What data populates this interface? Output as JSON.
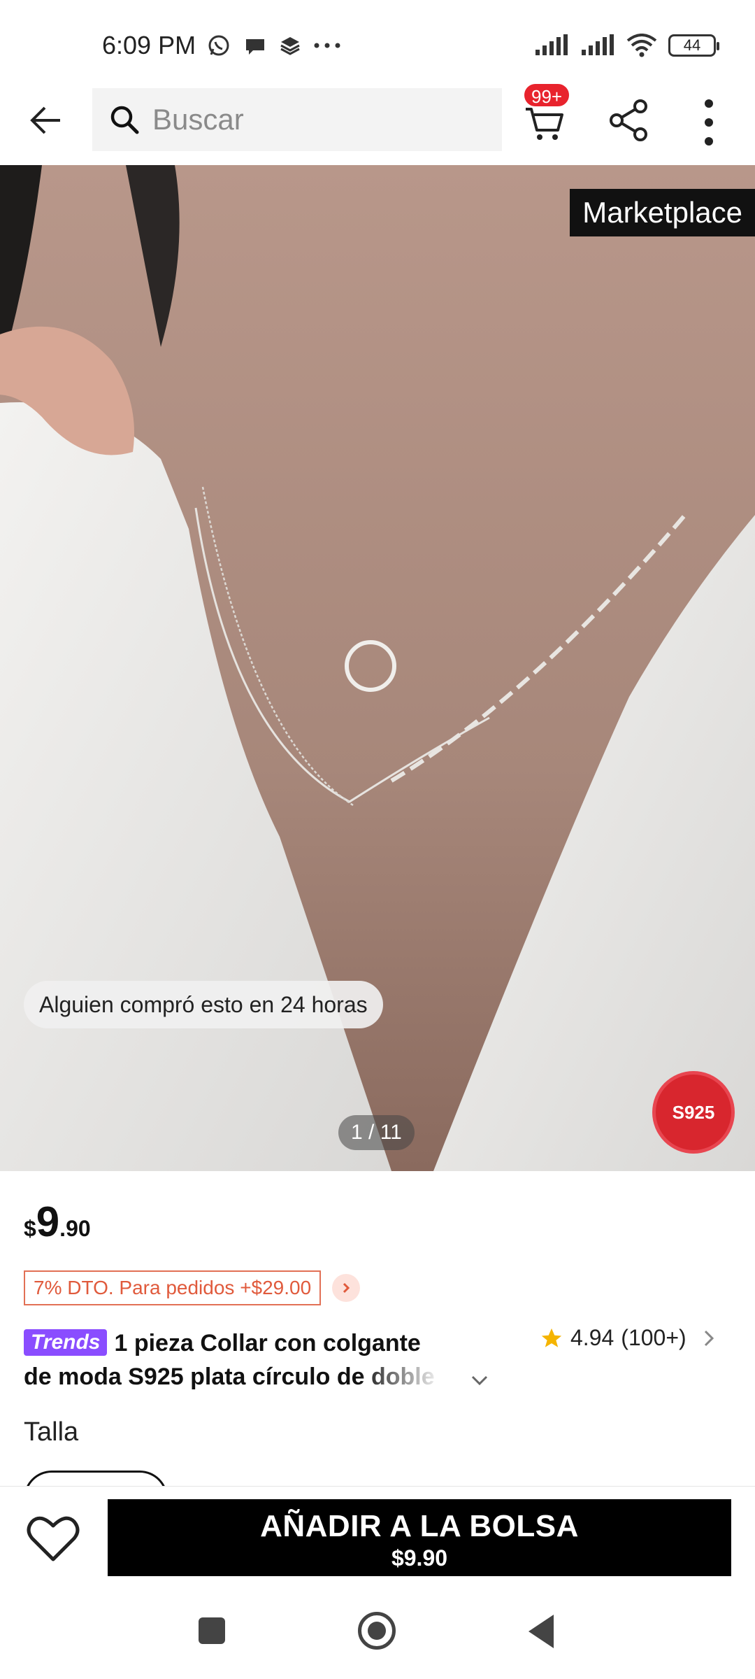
{
  "status_bar": {
    "time": "6:09 PM",
    "battery": "44",
    "icons": [
      "whatsapp-icon",
      "chat-bubble-icon",
      "layers-icon",
      "more-dots-icon",
      "signal-icon",
      "signal-icon",
      "wifi-icon",
      "battery-icon"
    ]
  },
  "top_nav": {
    "search_placeholder": "Buscar",
    "cart_badge": "99+"
  },
  "hero": {
    "marketplace_label": "Marketplace",
    "social_proof": "Alguien compró esto en 24 horas",
    "pager": "1 / 11",
    "badge": "S925"
  },
  "product": {
    "currency": "$",
    "price_int": "9",
    "price_dec": ".90",
    "promo": "7% DTO. Para pedidos +$29.00",
    "trends_label": "Trends",
    "title_line1": "1 pieza Collar con colgante",
    "title_line2": "de moda S925 plata círculo de doble",
    "rating": "4.94",
    "rating_count": "(100+)",
    "size_label": "Talla"
  },
  "bottom_bar": {
    "add_label": "AÑADIR A LA BOLSA",
    "add_price": "$9.90"
  },
  "colors": {
    "accent_red": "#e8232d",
    "promo_orange": "#e05a3c",
    "trends_purple": "#8a4dff",
    "star_yellow": "#f5b400"
  }
}
